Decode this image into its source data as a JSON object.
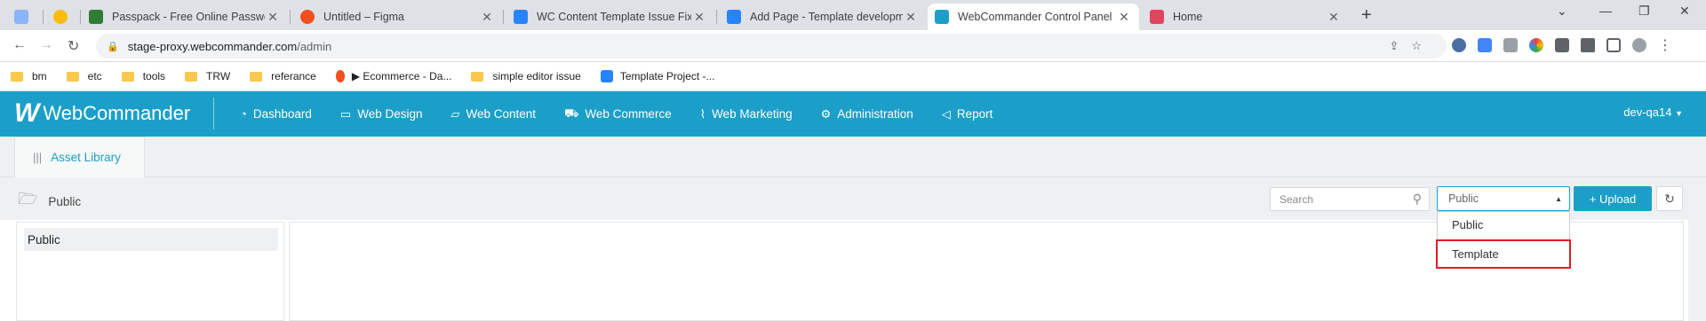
{
  "browser": {
    "tabs": [
      {
        "title": "",
        "favicon_color": "#8ab4f8"
      },
      {
        "title": "",
        "favicon_color": "#fbbc04"
      },
      {
        "title": "Passpack - Free Online Password",
        "favicon_color": "#2e7d32"
      },
      {
        "title": "Untitled – Figma",
        "favicon_color": "#f24e1e"
      },
      {
        "title": "WC Content Template Issue Fixing",
        "favicon_color": "#2684ff"
      },
      {
        "title": "Add Page - Template development",
        "favicon_color": "#2684ff"
      },
      {
        "title": "WebCommander Control Panel",
        "favicon_color": "#1b9fc9"
      },
      {
        "title": "Home",
        "favicon_color": "#e2445c"
      }
    ],
    "url_host": "stage-proxy.webcommander.com",
    "url_path": "/admin",
    "bookmarks": [
      {
        "label": "bm",
        "icon": "folder-icon"
      },
      {
        "label": "etc",
        "icon": "folder-icon"
      },
      {
        "label": "tools",
        "icon": "folder-icon"
      },
      {
        "label": "TRW",
        "icon": "folder-icon"
      },
      {
        "label": "referance",
        "icon": "folder-icon"
      },
      {
        "label": "▶ Ecommerce - Da...",
        "icon": "figma-icon"
      },
      {
        "label": "simple editor issue",
        "icon": "folder-icon"
      },
      {
        "label": "Template Project -...",
        "icon": "confluence-icon"
      }
    ]
  },
  "app": {
    "logo_text": "WebCommander",
    "nav": [
      {
        "label": "Dashboard",
        "icon": "dashboard-icon"
      },
      {
        "label": "Web Design",
        "icon": "monitor-icon"
      },
      {
        "label": "Web Content",
        "icon": "folder-icon"
      },
      {
        "label": "Web Commerce",
        "icon": "cart-icon"
      },
      {
        "label": "Web Marketing",
        "icon": "chart-icon"
      },
      {
        "label": "Administration",
        "icon": "gear-icon"
      },
      {
        "label": "Report",
        "icon": "megaphone-icon"
      }
    ],
    "user": "dev-qa14",
    "subtab": "Asset Library",
    "breadcrumb": "Public",
    "search_placeholder": "Search",
    "select_value": "Public",
    "upload_label": "+ Upload",
    "dropdown_options": [
      "Public",
      "Template"
    ],
    "left_items": [
      "Public"
    ],
    "colors": {
      "accent": "#1b9fc9",
      "highlight": "#e21d25"
    }
  }
}
